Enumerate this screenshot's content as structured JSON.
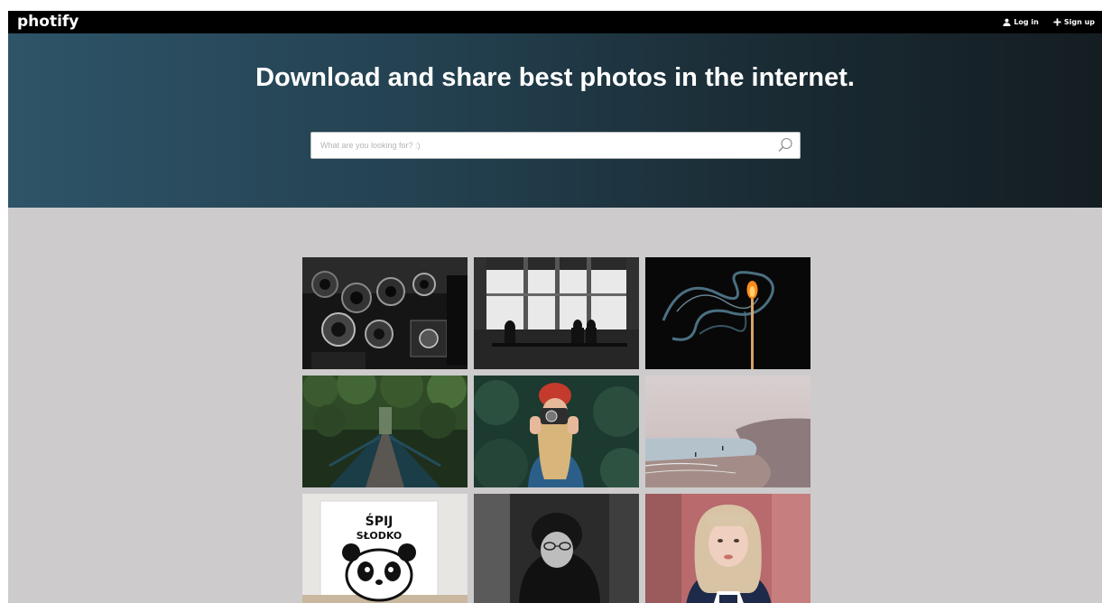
{
  "header": {
    "logo": "photify",
    "nav": {
      "login_label": "Log in",
      "signup_label": "Sign up"
    }
  },
  "hero": {
    "title": "Download and share best photos in the internet.",
    "search": {
      "placeholder": "What are you looking for? :)",
      "value": ""
    }
  },
  "gallery": {
    "photos": [
      {
        "id": "vintage-cameras",
        "alt": ""
      },
      {
        "id": "cafe-silhouettes",
        "alt": ""
      },
      {
        "id": "match-smoke",
        "alt": ""
      },
      {
        "id": "forest-bridge",
        "alt": ""
      },
      {
        "id": "woman-camera",
        "alt": ""
      },
      {
        "id": "misty-beach",
        "alt": ""
      },
      {
        "id": "panda-poster",
        "alt": "",
        "poster_text_line1": "ŚPIJ",
        "poster_text_line2": "SŁODKO"
      },
      {
        "id": "man-glasses",
        "alt": ""
      },
      {
        "id": "blonde-girl",
        "alt": ""
      }
    ]
  },
  "colors": {
    "topbar": "#000000",
    "hero_start": "#2e5468",
    "hero_end": "#141d22",
    "page_bg": "#cdcbcc"
  }
}
